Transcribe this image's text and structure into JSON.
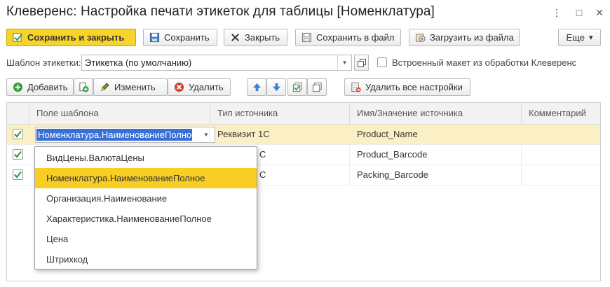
{
  "window": {
    "title": "Клеверенс: Настройка печати этикеток для таблицы [Номенклатура]",
    "menu_glyph": "⋮",
    "minimize_glyph": "□",
    "close_glyph": "×"
  },
  "toolbar": {
    "save_close": "Сохранить и закрыть",
    "save": "Сохранить",
    "close": "Закрыть",
    "save_file": "Сохранить в файл",
    "load_file": "Загрузить из файла",
    "more": "Еще",
    "more_arrow": "▾"
  },
  "template": {
    "label": "Шаблон этикетки:",
    "value": "Этикетка (по умолчанию)",
    "builtin_label": "Встроенный макет из обработки Клеверенс",
    "builtin_checked": false
  },
  "actions": {
    "add": "Добавить",
    "edit": "Изменить",
    "delete": "Удалить",
    "delete_all": "Удалить все настройки"
  },
  "table": {
    "columns": [
      "Поле шаблона",
      "Тип источника",
      "Имя/Значение источника",
      "Комментарий"
    ],
    "rows": [
      {
        "checked": true,
        "field": "Номенклатура.НаименованиеПолное",
        "type": "Реквизит 1С",
        "name": "Product_Name",
        "comment": ""
      },
      {
        "checked": true,
        "field": "",
        "type": "С",
        "name": "Product_Barcode",
        "comment": ""
      },
      {
        "checked": true,
        "field": "",
        "type": "С",
        "name": "Packing_Barcode",
        "comment": ""
      }
    ]
  },
  "dropdown": {
    "items": [
      "ВидЦены.ВалютаЦены",
      "Номенклатура.НаименованиеПолное",
      "Организация.Наименование",
      "Характеристика.НаименованиеПолное",
      "Цена",
      "Штрихкод"
    ],
    "active_index": 1
  },
  "colors": {
    "accent": "#f8d32a",
    "selection": "#3a6fd4",
    "row_selected": "#fbf0c5",
    "check": "#2e9c3a"
  }
}
